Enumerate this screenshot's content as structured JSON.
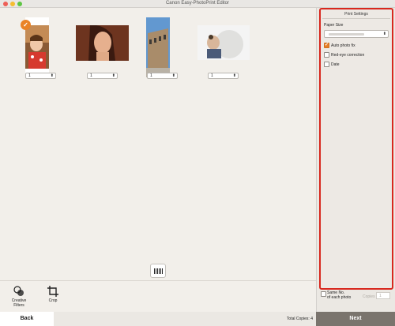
{
  "window": {
    "title": "Canon Easy-PhotoPrint Editor"
  },
  "photos": [
    {
      "quantity": "1",
      "selected": true
    },
    {
      "quantity": "1",
      "selected": false
    },
    {
      "quantity": "1",
      "selected": false
    },
    {
      "quantity": "1",
      "selected": false
    }
  ],
  "tools": {
    "creative_filters": "Creative\nFilters",
    "crop": "Crop"
  },
  "footer": {
    "back_label": "Back",
    "total_copies": "Total Copies: 4",
    "next_label": "Next"
  },
  "print_settings": {
    "title": "Print Settings",
    "paper_size_label": "Paper Size",
    "auto_photo_fix": {
      "label": "Auto photo fix",
      "checked": true
    },
    "red_eye_correction": {
      "label": "Red-eye correction",
      "checked": false
    },
    "date": {
      "label": "Date",
      "checked": false
    }
  },
  "same_no": {
    "label": "Same No.\nof each photo",
    "checked": false
  },
  "copies": {
    "label": "Copies",
    "value": "1"
  },
  "colors": {
    "highlight_border": "#d8281e",
    "accent_orange": "#ea8326",
    "next_button": "#7a746d"
  }
}
